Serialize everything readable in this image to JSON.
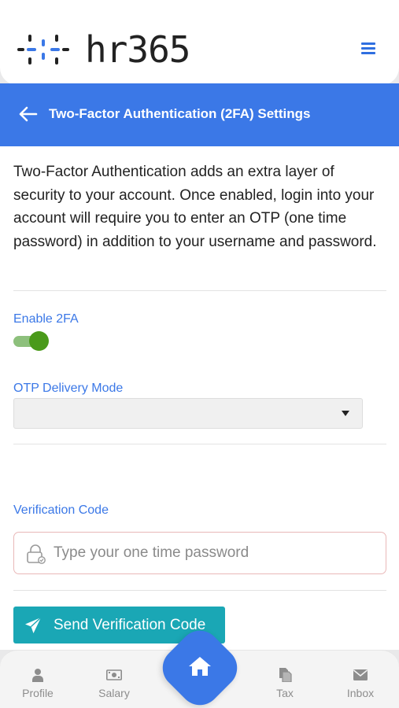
{
  "app": {
    "logo_text": "hr365"
  },
  "header": {
    "title": "Two-Factor Authentication (2FA) Settings"
  },
  "content": {
    "description": "Two-Factor Authentication adds an extra layer of security to your account. Once enabled, login into your account will require you to enter an OTP (one time password) in addition to your username and password.",
    "enable_label": "Enable 2FA",
    "enable_state": true,
    "delivery_label": "OTP Delivery Mode",
    "delivery_value": "",
    "verification_label": "Verification Code",
    "otp_placeholder": "Type your one time password",
    "otp_value": "",
    "send_button": "Send Verification Code"
  },
  "bottom_nav": {
    "items": [
      {
        "label": "Profile",
        "icon": "person-icon"
      },
      {
        "label": "Salary",
        "icon": "money-icon"
      },
      {
        "label": "Home",
        "icon": "home-icon"
      },
      {
        "label": "Tax",
        "icon": "documents-icon"
      },
      {
        "label": "Inbox",
        "icon": "envelope-icon"
      }
    ]
  },
  "colors": {
    "primary": "#3b78e7",
    "label_blue": "#3b78e7",
    "button_teal": "#1aa7b5",
    "toggle_on": "#4a9a1a",
    "toggle_track": "#8dc07c",
    "nav_grey": "#8d8d8d"
  }
}
